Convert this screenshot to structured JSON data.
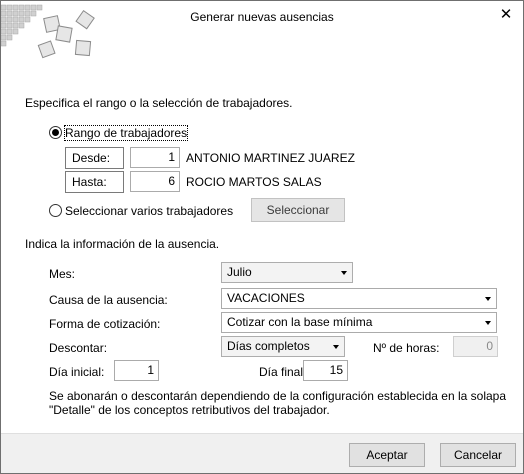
{
  "window": {
    "title": "Generar nuevas ausencias",
    "close_glyph": "✕"
  },
  "workers": {
    "heading": "Especifica el rango o la selección de trabajadores.",
    "option_range": "Rango de trabajadores",
    "option_range_selected": true,
    "from_label": "Desde:",
    "from_value": "1",
    "from_name": "ANTONIO MARTINEZ JUAREZ",
    "to_label": "Hasta:",
    "to_value": "6",
    "to_name": "ROCIO MARTOS SALAS",
    "option_select": "Seleccionar varios trabajadores",
    "select_button": "Seleccionar"
  },
  "absence": {
    "heading": "Indica la información de la ausencia.",
    "month_label": "Mes:",
    "month_value": "Julio",
    "cause_label": "Causa de la ausencia:",
    "cause_value": "VACACIONES",
    "contribution_label": "Forma de cotización:",
    "contribution_value": "Cotizar con la base mínima",
    "deduct_label": "Descontar:",
    "deduct_value": "Días completos",
    "hours_label": "Nº de horas:",
    "hours_value": "0",
    "start_day_label": "Día inicial:",
    "start_day_value": "1",
    "end_day_label": "Día final:",
    "end_day_value": "15",
    "note_line1": "Se abonarán o descontarán dependiendo de la configuración establecida en la solapa",
    "note_line2": "\"Detalle\" de los conceptos retributivos del trabajador."
  },
  "footer": {
    "accept_label": "Aceptar",
    "cancel_label": "Cancelar"
  },
  "icons": {
    "logo": "tiled-squares-logo-icon",
    "close": "close-icon",
    "dropdown": "chevron-down-icon"
  },
  "colors": {
    "dialog_bg": "#f0f0f0",
    "content_bg": "#ffffff",
    "logo_square": "#c8c8c8"
  }
}
